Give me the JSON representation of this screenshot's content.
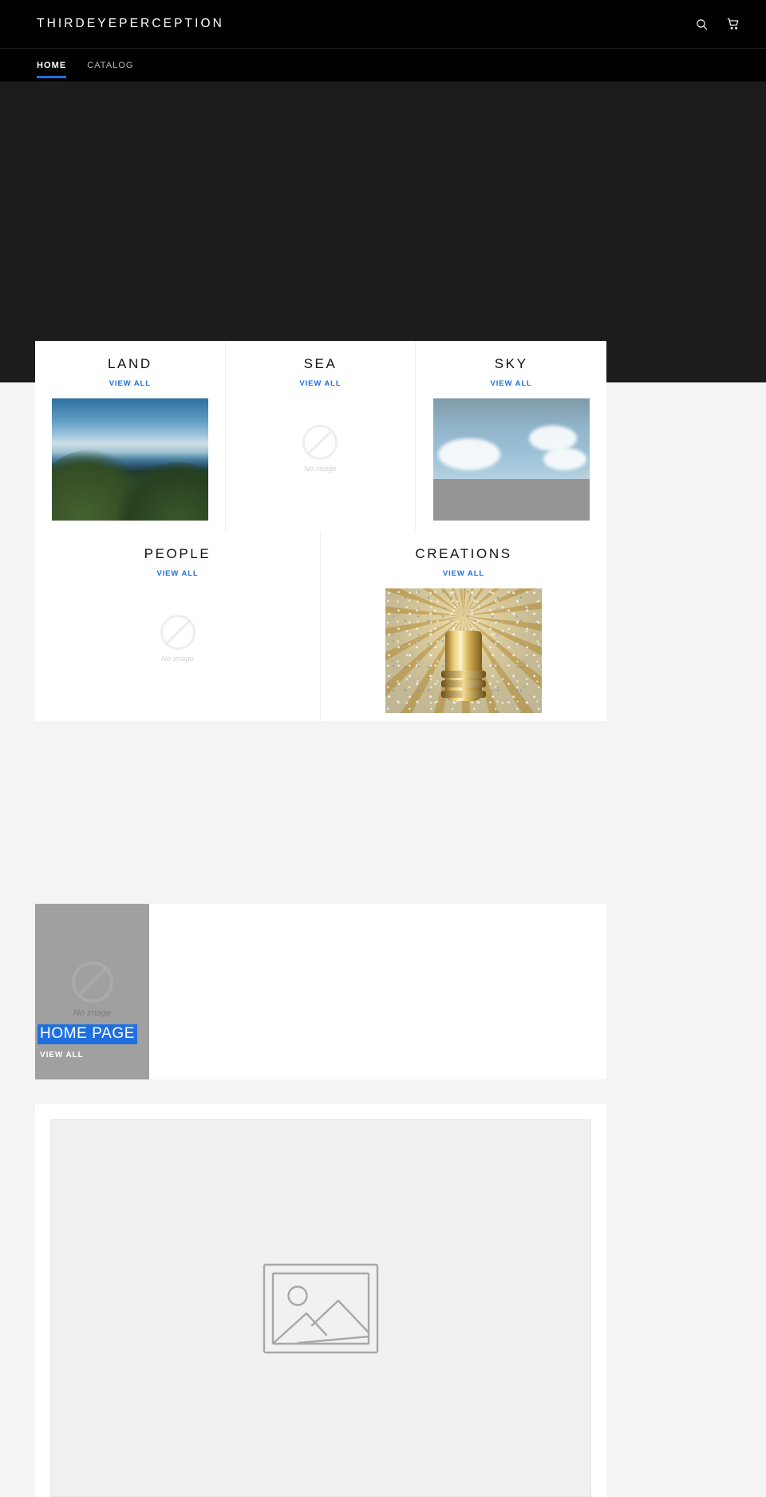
{
  "header": {
    "logo": "THIRDEYEPERCEPTION",
    "search_icon": "search-icon",
    "cart_icon": "shopping-cart-icon"
  },
  "nav": {
    "items": [
      {
        "label": "HOME",
        "active": true
      },
      {
        "label": "CATALOG",
        "active": false
      }
    ]
  },
  "hero": {
    "background_color": "#1c1c1c"
  },
  "collections": {
    "view_all_label": "VIEW ALL",
    "no_image_label": "No image",
    "row1": [
      {
        "title": "LAND",
        "view_all": "VIEW ALL",
        "has_image": true,
        "art": "coastal-hills"
      },
      {
        "title": "SEA",
        "view_all": "VIEW ALL",
        "has_image": false,
        "no_image_label": "No image"
      },
      {
        "title": "SKY",
        "view_all": "VIEW ALL",
        "has_image": true,
        "art": "rainbow-clouds"
      }
    ],
    "row2": [
      {
        "title": "PEOPLE",
        "view_all": "VIEW ALL",
        "has_image": false,
        "no_image_label": "No image"
      },
      {
        "title": "CREATIONS",
        "view_all": "VIEW ALL",
        "has_image": true,
        "art": "golden-parasol"
      }
    ]
  },
  "featured": {
    "title": "HOME PAGE",
    "title_selected": true,
    "selection_color": "#1f6fe0",
    "view_all": "VIEW ALL",
    "no_image_label": "No image",
    "placeholder_color": "#a0a0a0"
  },
  "bottom_block": {
    "placeholder_icon": "image-placeholder-icon",
    "canvas_color": "#f1f1f1"
  },
  "colors": {
    "header_bg": "#000000",
    "hero_bg": "#1c1c1c",
    "page_bg": "#f4f4f4",
    "card_bg": "#ffffff",
    "link_blue": "#1f6fe0",
    "muted_text": "#b9b9b9"
  }
}
